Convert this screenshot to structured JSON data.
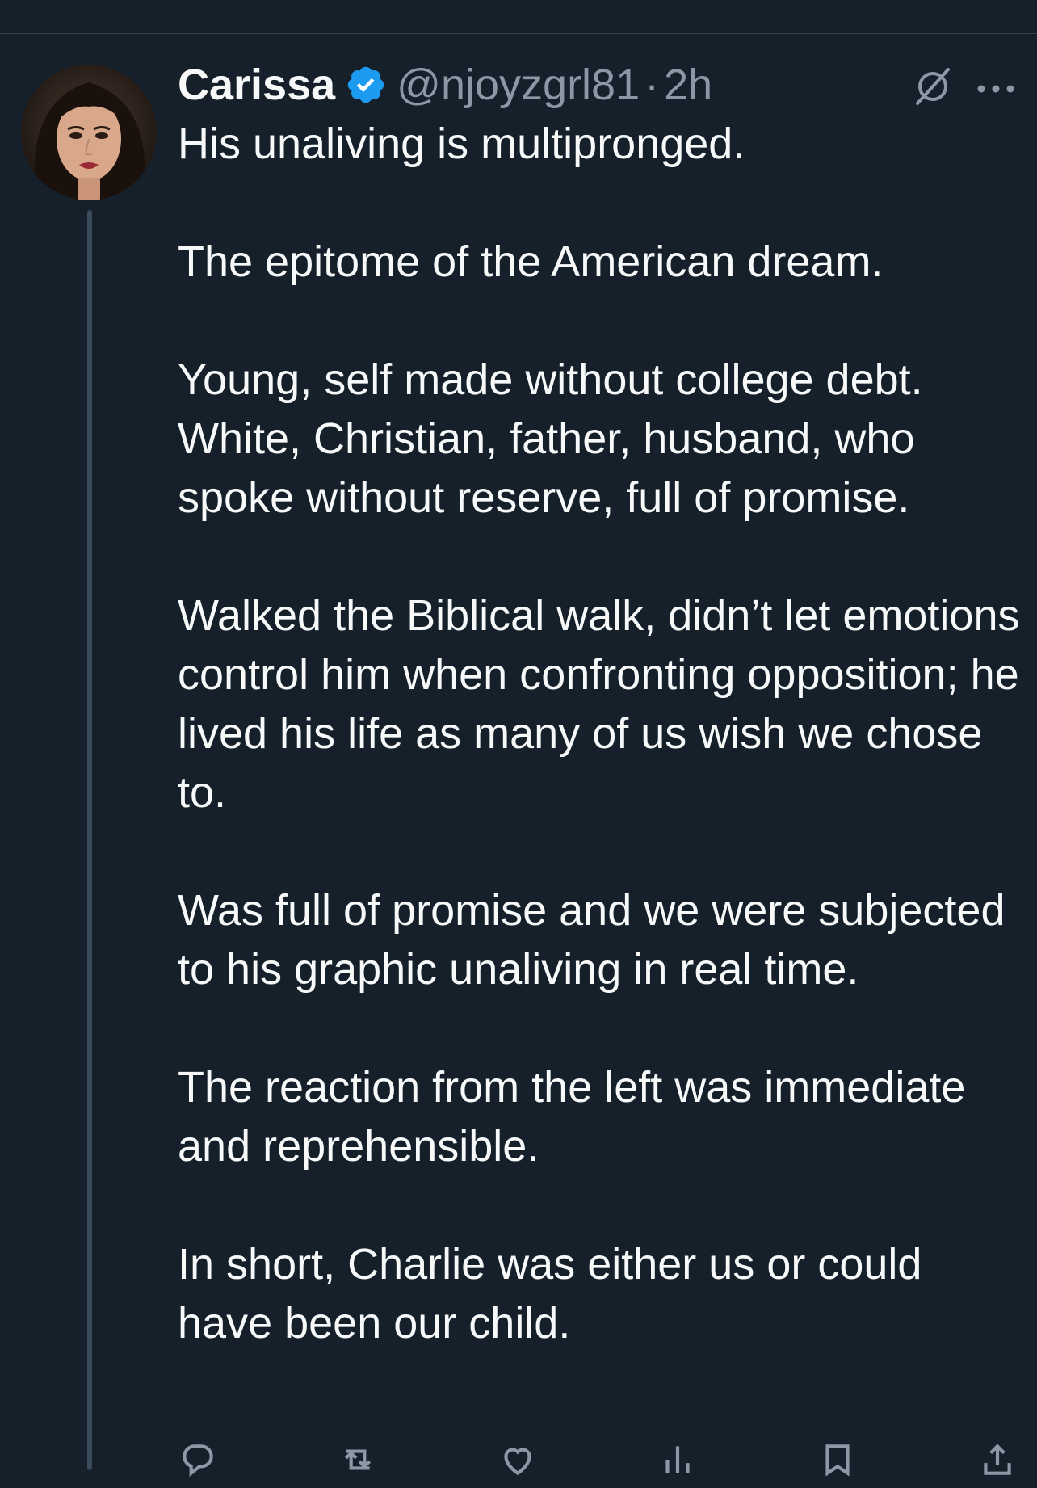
{
  "tweet": {
    "display_name": "Carissa",
    "handle": "@njoyzgrl81",
    "separator": "·",
    "time": "2h",
    "paragraphs": [
      "His unaliving is multipronged.",
      "The epitome of the American dream.",
      "Young, self made without college debt. White, Christian, father, husband, who spoke without reserve, full of promise.",
      "Walked the Biblical walk, didn’t let emotions control him when confronting opposition; he lived his life as many of us wish we chose to.",
      "Was full of promise and we were subjected to his graphic unaliving in real time.",
      "The reaction from the left was immediate and reprehensible.",
      "In short, Charlie was either us or could have been our child."
    ]
  },
  "icons": {
    "verified": "verified-badge-icon",
    "grok": "grok-icon",
    "more": "more-options-icon",
    "reply": "reply-icon",
    "retweet": "retweet-icon",
    "like": "like-icon",
    "views": "views-icon",
    "bookmark": "bookmark-icon",
    "share": "share-icon"
  },
  "colors": {
    "background": "#15202b",
    "text": "#f7f9f9",
    "secondary": "#8b98a5",
    "verified": "#1d9bf0",
    "thread_line": "#3a4b5c"
  }
}
